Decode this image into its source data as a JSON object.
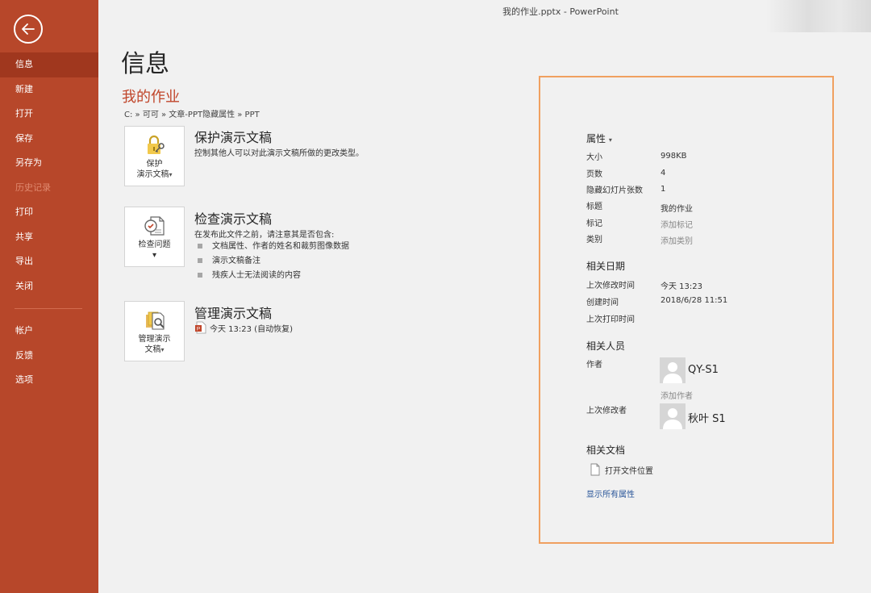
{
  "window": {
    "title": "我的作业.pptx  -  PowerPoint"
  },
  "nav": {
    "items": [
      "信息",
      "新建",
      "打开",
      "保存",
      "另存为",
      "历史记录",
      "打印",
      "共享",
      "导出",
      "关闭"
    ],
    "bottom_items": [
      "帐户",
      "反馈",
      "选项"
    ]
  },
  "main": {
    "title": "信息",
    "doc_name": "我的作业",
    "path": "C: » 可可 » 文章-PPT隐藏属性 » PPT",
    "protect": {
      "tile_label_1": "保护",
      "tile_label_2": "演示文稿",
      "title": "保护演示文稿",
      "desc": "控制其他人可以对此演示文稿所做的更改类型。"
    },
    "inspect": {
      "tile_label_1": "检查问题",
      "title": "检查演示文稿",
      "desc": "在发布此文件之前，请注意其是否包含:",
      "bullets": [
        "文档属性、作者的姓名和裁剪图像数据",
        "演示文稿备注",
        "残疾人士无法阅读的内容"
      ]
    },
    "manage": {
      "tile_label_1": "管理演示",
      "tile_label_2": "文稿",
      "title": "管理演示文稿",
      "autosave": "今天 13:23 (自动恢复)"
    }
  },
  "props": {
    "header": "属性",
    "rows": [
      {
        "label": "大小",
        "value": "998KB"
      },
      {
        "label": "页数",
        "value": "4"
      },
      {
        "label": "隐藏幻灯片张数",
        "value": "1"
      },
      {
        "label": "标题",
        "value": "我的作业"
      },
      {
        "label": "标记",
        "value": "添加标记"
      },
      {
        "label": "类别",
        "value": "添加类别"
      }
    ],
    "dates_header": "相关日期",
    "dates": [
      {
        "label": "上次修改时间",
        "value": "今天 13:23"
      },
      {
        "label": "创建时间",
        "value": "2018/6/28 11:51"
      },
      {
        "label": "上次打印时间",
        "value": ""
      }
    ],
    "people_header": "相关人员",
    "author_label": "作者",
    "author_name": "QY-S1",
    "add_author": "添加作者",
    "last_modifier_label": "上次修改者",
    "last_modifier_name": "秋叶 S1",
    "docs_header": "相关文档",
    "open_location": "打开文件位置",
    "show_all": "显示所有属性"
  }
}
